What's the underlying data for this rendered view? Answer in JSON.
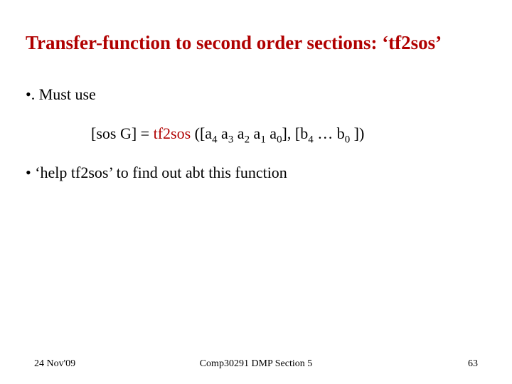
{
  "title": "Transfer-function to second order sections: ‘tf2sos’",
  "bullets": {
    "b1": "•. Must  use",
    "b2_prefix": "[sos G]  =  ",
    "b2_fn": "tf2sos",
    "b2_args_open": " ([a",
    "b2_a4": "4",
    "b2_sep1": "  a",
    "b2_a3": "3",
    "b2_sep2": "  a",
    "b2_a2": "2",
    "b2_sep3": "  a",
    "b2_a1": "1",
    "b2_sep4": " a",
    "b2_a0": "0",
    "b2_mid": "], [b",
    "b2_b4": "4",
    "b2_dots": " … b",
    "b2_b0": "0",
    "b2_close": " ])",
    "b3": "• ‘help tf2sos’    to find out abt this function"
  },
  "footer": {
    "left": "24 Nov'09",
    "center": "Comp30291 DMP Section 5",
    "right": "63"
  }
}
